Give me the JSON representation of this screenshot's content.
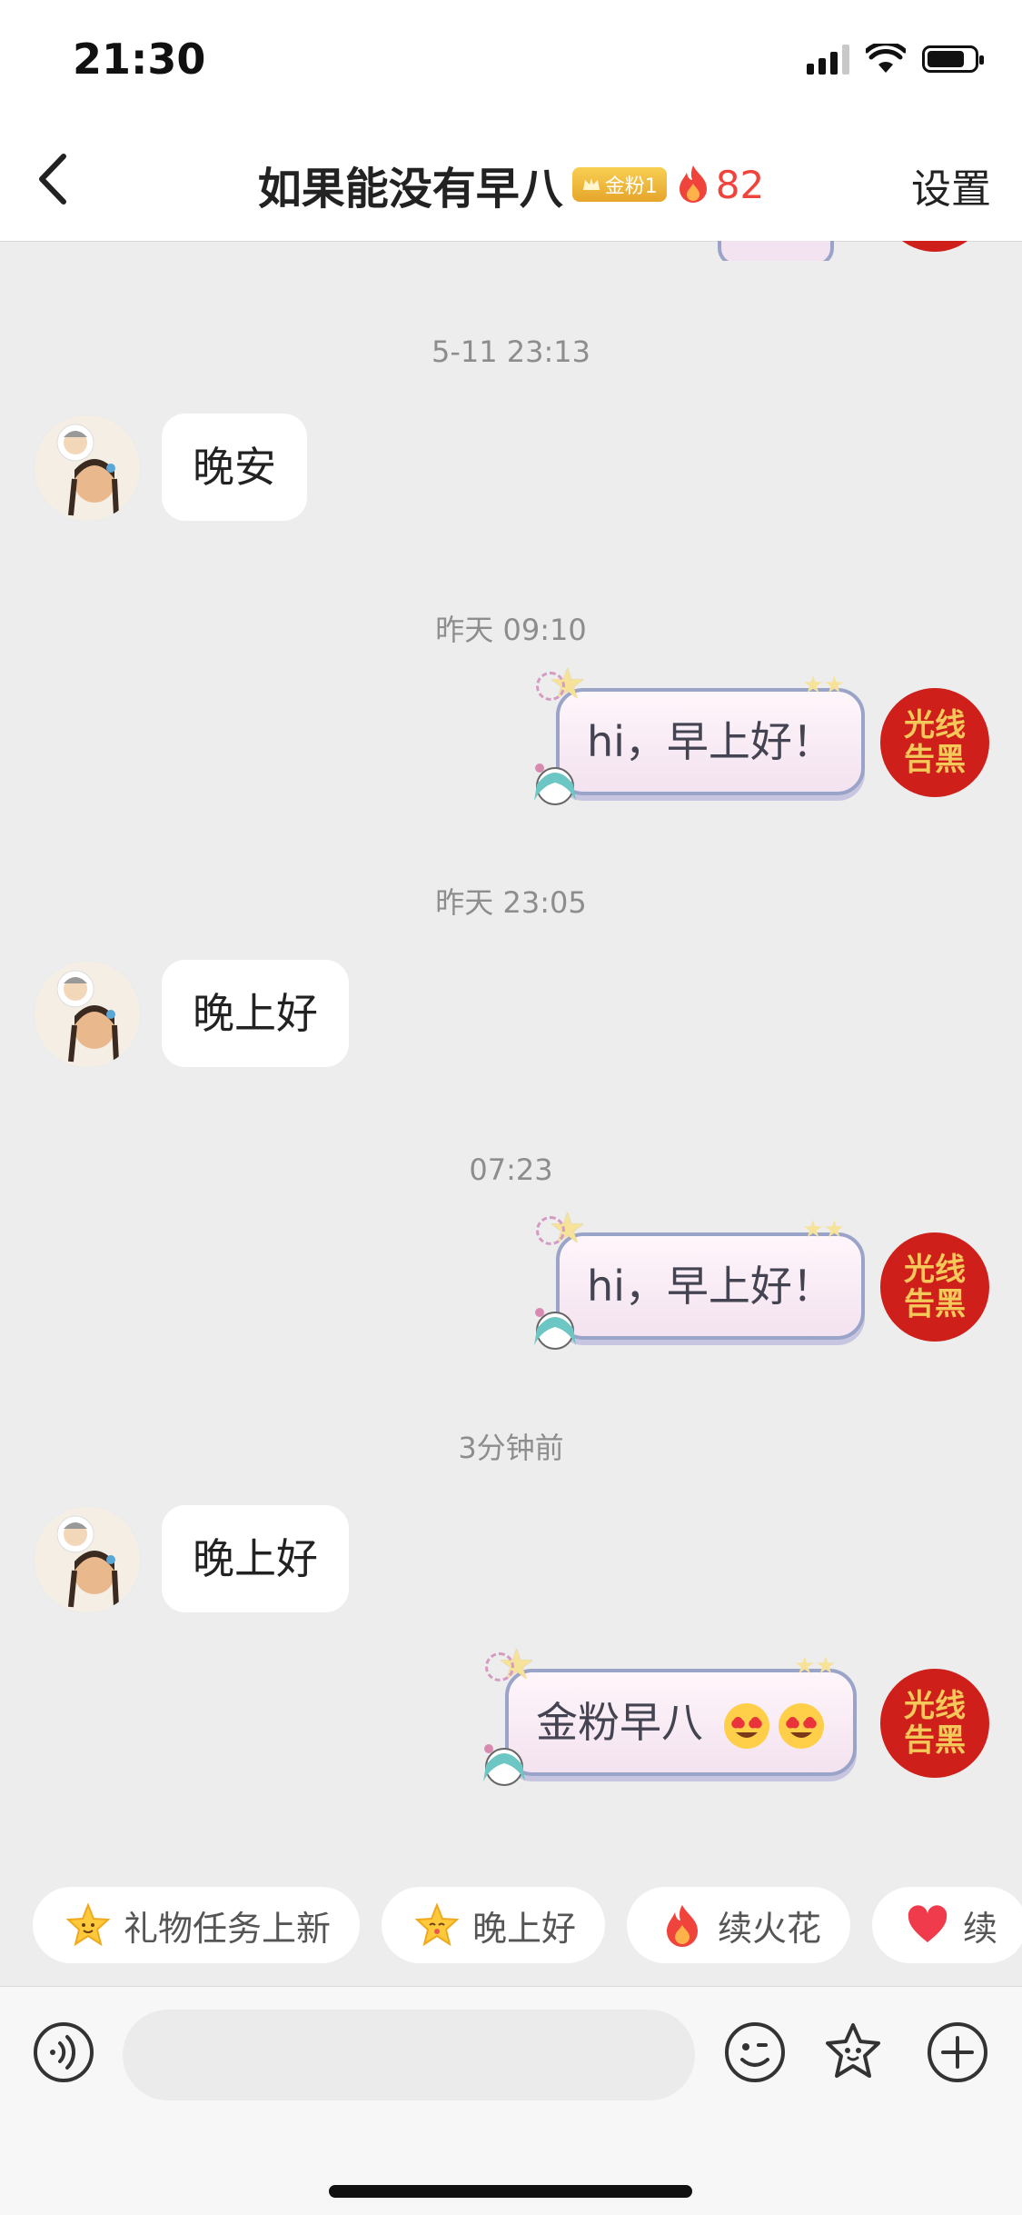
{
  "status_bar": {
    "time": "21:30",
    "icons": [
      "signal-icon",
      "wifi-icon",
      "battery-icon"
    ]
  },
  "header": {
    "title": "如果能没有早八",
    "fan_badge": "金粉1",
    "streak_count": "82",
    "settings_label": "设置"
  },
  "avatars": {
    "right_stamp_line1": "光线",
    "right_stamp_line2": "告黑"
  },
  "messages": {
    "ts1": "5-11 23:13",
    "msg1": "晚安",
    "ts2": "昨天 09:10",
    "msg2": "hi，早上好！",
    "ts3": "昨天 23:05",
    "msg3": "晚上好",
    "ts4": "07:23",
    "msg4": "hi，早上好！",
    "ts5": "3分钟前",
    "msg5": "晚上好",
    "msg6": "金粉早八"
  },
  "quick_replies": [
    {
      "label": "礼物任务上新",
      "icon": "star-smile-icon"
    },
    {
      "label": "晚上好",
      "icon": "star-face-icon"
    },
    {
      "label": "续火花",
      "icon": "fire-icon"
    },
    {
      "label": "续",
      "icon": "heart-icon"
    }
  ],
  "input": {
    "placeholder": ""
  },
  "colors": {
    "background": "#ededed",
    "streak_red": "#f0433c",
    "fan_gold": "#e6a52b",
    "stamp_red": "#cf1f1a"
  }
}
